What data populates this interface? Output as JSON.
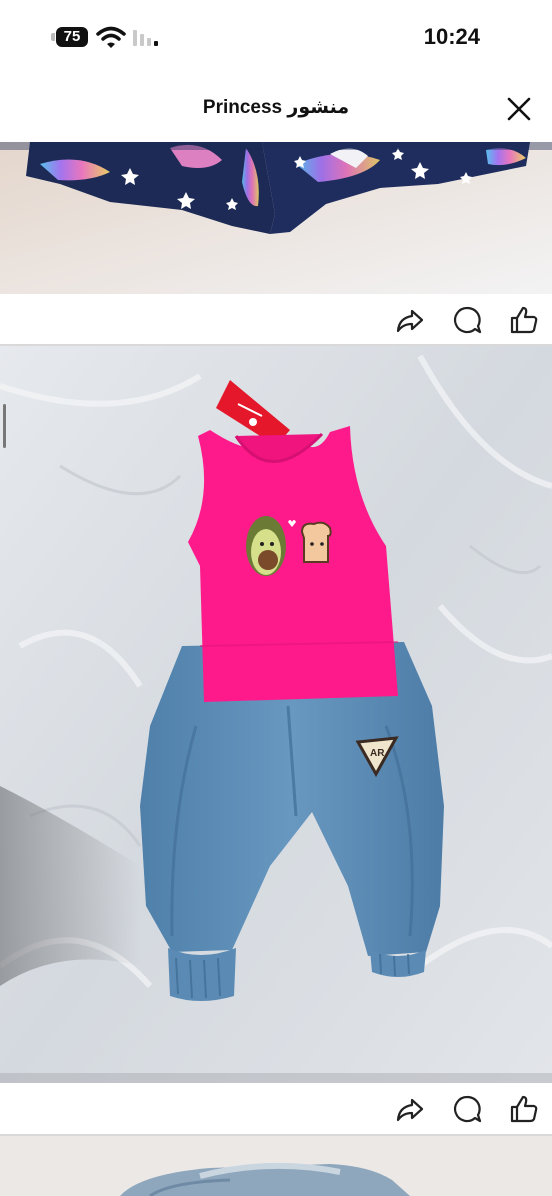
{
  "status_bar": {
    "battery": "75",
    "time": "10:24",
    "icons": [
      "battery-icon",
      "wifi-icon",
      "signal-icon"
    ]
  },
  "header": {
    "title": "منشور Princess",
    "close_icon": "close-icon"
  },
  "posts": [
    {
      "photo": "unicorn-shorts-photo",
      "actions": [
        "share-icon",
        "comment-icon",
        "like-icon"
      ]
    },
    {
      "photo": "pink-tank-top-denim-pants-photo",
      "actions": [
        "share-icon",
        "comment-icon",
        "like-icon"
      ]
    },
    {
      "photo": "denim-clothing-photo"
    }
  ],
  "colors": {
    "background": "#ffffff",
    "tank_top": "#ff1a8c",
    "denim": "#5f8fb8",
    "navy_print": "#1c2a55",
    "icon": "#222222"
  }
}
